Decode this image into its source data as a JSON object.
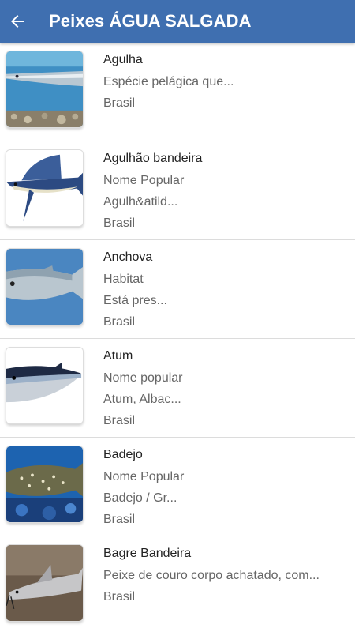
{
  "appbar": {
    "title": "Peixes ÁGUA SALGADA",
    "back_icon": "arrow-left-icon",
    "color": "#3f6fb0"
  },
  "fish": [
    {
      "name": "Agulha",
      "lines": [
        "Espécie pelágica que...",
        "Brasil"
      ]
    },
    {
      "name": "Agulhão bandeira",
      "lines": [
        "Nome Popular",
        "Agulh&atild...",
        "Brasil"
      ]
    },
    {
      "name": "Anchova",
      "lines": [
        "Habitat",
        "Está pres...",
        "Brasil"
      ]
    },
    {
      "name": "Atum",
      "lines": [
        "Nome popular",
        "Atum, Albac...",
        "Brasil"
      ]
    },
    {
      "name": "Badejo",
      "lines": [
        "Nome Popular",
        "Badejo / Gr...",
        "Brasil"
      ]
    },
    {
      "name": "Bagre Bandeira",
      "lines": [
        "Peixe de couro corpo achatado, com...",
        "Brasil"
      ]
    }
  ]
}
